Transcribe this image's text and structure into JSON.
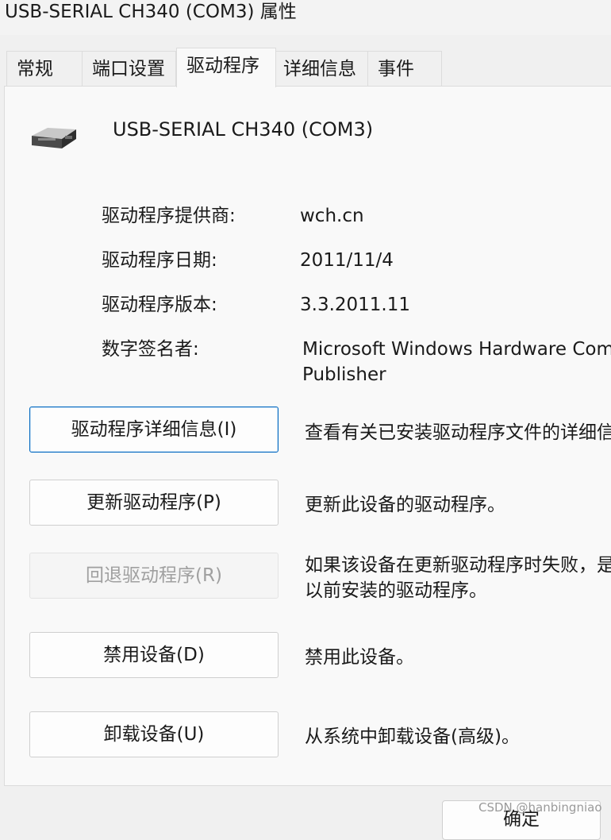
{
  "window": {
    "title": "USB-SERIAL CH340 (COM3) 属性"
  },
  "tabs": [
    {
      "label": "常规"
    },
    {
      "label": "端口设置"
    },
    {
      "label": "驱动程序",
      "active": true
    },
    {
      "label": "详细信息"
    },
    {
      "label": "事件"
    }
  ],
  "device": {
    "name": "USB-SERIAL CH340 (COM3)",
    "icon": "serial-port-icon"
  },
  "driver_info": [
    {
      "label": "驱动程序提供商:",
      "value": "wch.cn"
    },
    {
      "label": "驱动程序日期:",
      "value": "2011/11/4"
    },
    {
      "label": "驱动程序版本:",
      "value": "3.3.2011.11"
    },
    {
      "label": "数字签名者:",
      "value": "Microsoft Windows Hardware Comp",
      "value_line2": "Publisher"
    }
  ],
  "actions": [
    {
      "button": "驱动程序详细信息(I)",
      "description": "查看有关已安装驱动程序文件的详细信"
    },
    {
      "button": "更新驱动程序(P)",
      "description": "更新此设备的驱动程序。"
    },
    {
      "button": "回退驱动程序(R)",
      "description": "如果该设备在更新驱动程序时失败，是",
      "description_line2": "以前安装的驱动程序。",
      "disabled": true
    },
    {
      "button": "禁用设备(D)",
      "description": "禁用此设备。"
    },
    {
      "button": "卸载设备(U)",
      "description": "从系统中卸载设备(高级)。"
    }
  ],
  "footer": {
    "ok_label": "确定",
    "watermark": "CSDN @hanbingniao"
  },
  "colors": {
    "accent": "#0067c0",
    "disabled_text": "#a0a0a0"
  }
}
